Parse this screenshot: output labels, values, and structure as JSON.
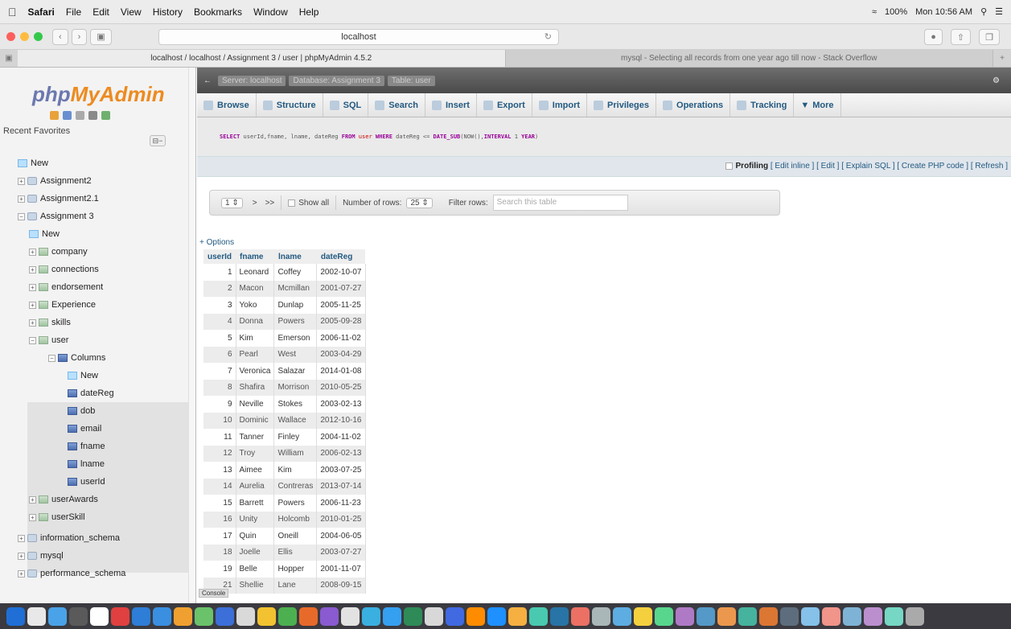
{
  "menubar": {
    "app": "Safari",
    "items": [
      "File",
      "Edit",
      "View",
      "History",
      "Bookmarks",
      "Window",
      "Help"
    ],
    "battery": "100%",
    "clock": "Mon 10:56 AM"
  },
  "toolbar": {
    "url": "localhost"
  },
  "tabs": [
    "localhost / localhost / Assignment 3 / user | phpMyAdmin 4.5.2",
    "mysql - Selecting all records from one year ago till now - Stack Overflow"
  ],
  "sidebar": {
    "logo_php": "php",
    "logo_rest": "MyAdmin",
    "recent_favorites": "Recent  Favorites",
    "tree": [
      {
        "label": "New",
        "type": "new",
        "level": 0
      },
      {
        "label": "Assignment2",
        "type": "db",
        "level": 0
      },
      {
        "label": "Assignment2.1",
        "type": "db",
        "level": 0
      },
      {
        "label": "Assignment 3",
        "type": "db",
        "level": 0
      },
      {
        "label": "New",
        "type": "new",
        "level": 1
      },
      {
        "label": "company",
        "type": "tbl",
        "level": 1
      },
      {
        "label": "connections",
        "type": "tbl",
        "level": 1
      },
      {
        "label": "endorsement",
        "type": "tbl",
        "level": 1
      },
      {
        "label": "Experience",
        "type": "tbl",
        "level": 1
      },
      {
        "label": "skills",
        "type": "tbl",
        "level": 1
      },
      {
        "label": "user",
        "type": "tbl",
        "level": 1
      },
      {
        "label": "Columns",
        "type": "col",
        "level": 2
      },
      {
        "label": "New",
        "type": "new",
        "level": 3
      },
      {
        "label": "dateReg",
        "type": "col",
        "level": 3
      },
      {
        "label": "dob",
        "type": "col",
        "level": 3
      },
      {
        "label": "email",
        "type": "col",
        "level": 3
      },
      {
        "label": "fname",
        "type": "col",
        "level": 3
      },
      {
        "label": "lname",
        "type": "col",
        "level": 3
      },
      {
        "label": "userId",
        "type": "col",
        "level": 3
      },
      {
        "label": "userAwards",
        "type": "tbl",
        "level": 1
      },
      {
        "label": "userSkill",
        "type": "tbl",
        "level": 1
      },
      {
        "label": "information_schema",
        "type": "db",
        "level": 0
      },
      {
        "label": "mysql",
        "type": "db",
        "level": 0
      },
      {
        "label": "performance_schema",
        "type": "db",
        "level": 0
      }
    ]
  },
  "breadcrumb": [
    "Server: localhost",
    "Database: Assignment 3",
    "Table: user"
  ],
  "menu": [
    "Browse",
    "Structure",
    "SQL",
    "Search",
    "Insert",
    "Export",
    "Import",
    "Privileges",
    "Operations",
    "Tracking",
    "More"
  ],
  "sql": {
    "select": "SELECT",
    "cols": " userId,fname, lname, dateReg ",
    "from": "FROM",
    "table": " user ",
    "where": "WHERE",
    "cond": " dateReg <= ",
    "func": "DATE_SUB",
    "args": "(NOW(),",
    "interval": "INTERVAL",
    "n": " 1 ",
    "year": "YEAR",
    "close": ")"
  },
  "profiling": {
    "label": "Profiling",
    "links": "[ Edit inline ] [ Edit ] [ Explain SQL ] [ Create PHP code ] [ Refresh ]"
  },
  "nav": {
    "page": "1",
    "next": ">",
    "last": ">>",
    "show_all": "Show all",
    "rows_label": "Number of rows:",
    "rows_value": "25",
    "filter_label": "Filter rows:",
    "filter_placeholder": "Search this table"
  },
  "options_link": "+ Options",
  "table": {
    "headers": [
      "userId",
      "fname",
      "lname",
      "dateReg"
    ],
    "rows": [
      [
        "1",
        "Leonard",
        "Coffey",
        "2002-10-07"
      ],
      [
        "2",
        "Macon",
        "Mcmillan",
        "2001-07-27"
      ],
      [
        "3",
        "Yoko",
        "Dunlap",
        "2005-11-25"
      ],
      [
        "4",
        "Donna",
        "Powers",
        "2005-09-28"
      ],
      [
        "5",
        "Kim",
        "Emerson",
        "2006-11-02"
      ],
      [
        "6",
        "Pearl",
        "West",
        "2003-04-29"
      ],
      [
        "7",
        "Veronica",
        "Salazar",
        "2014-01-08"
      ],
      [
        "8",
        "Shafira",
        "Morrison",
        "2010-05-25"
      ],
      [
        "9",
        "Neville",
        "Stokes",
        "2003-02-13"
      ],
      [
        "10",
        "Dominic",
        "Wallace",
        "2012-10-16"
      ],
      [
        "11",
        "Tanner",
        "Finley",
        "2004-11-02"
      ],
      [
        "12",
        "Troy",
        "William",
        "2006-02-13"
      ],
      [
        "13",
        "Aimee",
        "Kim",
        "2003-07-25"
      ],
      [
        "14",
        "Aurelia",
        "Contreras",
        "2013-07-14"
      ],
      [
        "15",
        "Barrett",
        "Powers",
        "2006-11-23"
      ],
      [
        "16",
        "Unity",
        "Holcomb",
        "2010-01-25"
      ],
      [
        "17",
        "Quin",
        "Oneill",
        "2004-06-05"
      ],
      [
        "18",
        "Joelle",
        "Ellis",
        "2003-07-27"
      ],
      [
        "19",
        "Belle",
        "Hopper",
        "2001-11-07"
      ],
      [
        "21",
        "Shellie",
        "Lane",
        "2008-09-15"
      ]
    ]
  },
  "console": "Console"
}
